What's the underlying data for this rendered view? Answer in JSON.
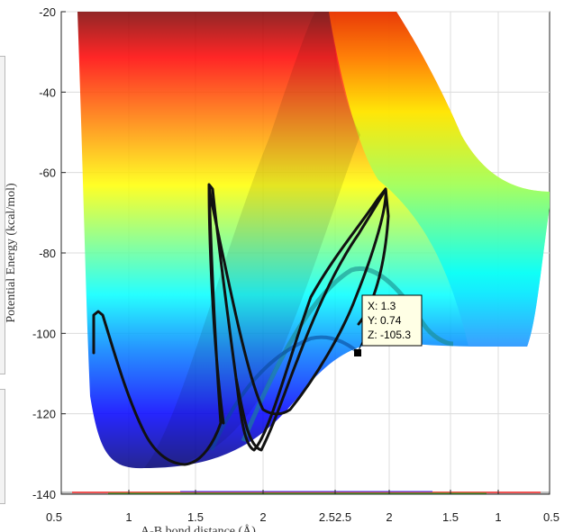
{
  "chart_data": {
    "type": "surface",
    "surface_colormap": "jet",
    "grid": true,
    "x_axis": {
      "ticks": [
        "0.5",
        "1",
        "1.5",
        "2",
        "2.52.5",
        "2",
        "1.5",
        "1",
        "0.5"
      ],
      "label": "A-B bond distance (Å)"
    },
    "y_axis": {
      "ticks": [
        "-20",
        "-40",
        "-60",
        "-80",
        "-100",
        "-120",
        "-140"
      ],
      "label": "Potential Energy (kcal/mol)",
      "range": [
        -140,
        -20
      ]
    },
    "trajectory_color": "#111111",
    "data_tip": {
      "lines": [
        "X: 1.3",
        "Y: 0.74",
        "Z: -105.3"
      ],
      "x": 1.3,
      "y": 0.74,
      "z": -105.3
    }
  }
}
